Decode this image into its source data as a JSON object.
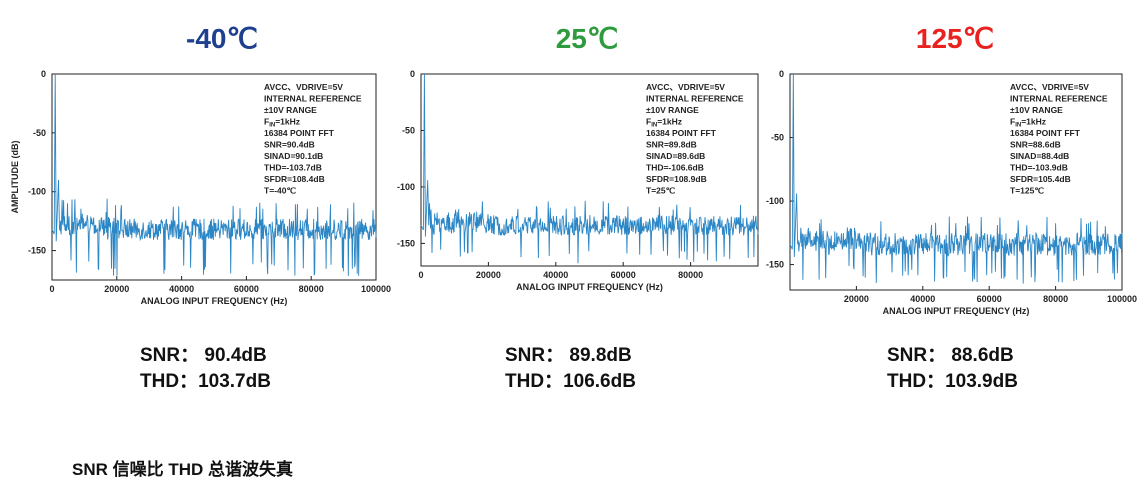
{
  "footer_note": "SNR 信噪比  THD 总谐波失真",
  "chart_data": [
    {
      "type": "line",
      "temperature_label": "-40℃",
      "temperature_color": "#1f3f8f",
      "xlabel": "ANALOG INPUT FREQUENCY (Hz)",
      "ylabel": "AMPLITUDE (dB)",
      "xlim": [
        0,
        100000
      ],
      "ylim": [
        -175,
        0
      ],
      "xticks": [
        0,
        20000,
        40000,
        60000,
        80000,
        100000
      ],
      "xtick_labels": [
        "0",
        "20000",
        "40000",
        "60000",
        "80000",
        "100000"
      ],
      "yticks": [
        0,
        -50,
        -100,
        -150
      ],
      "ytick_labels": [
        "0",
        "-50",
        "-100",
        "-150"
      ],
      "grid": false,
      "legend_position": "top-right",
      "series": [
        {
          "color": "#2b86c5",
          "fundamental": {
            "x": 1000,
            "y": 0
          },
          "noise_floor_db": -132,
          "noise_min_db": -172,
          "noise_max_db": -108
        }
      ],
      "annotations": [
        "AVCC、VDRIVE=5V",
        "INTERNAL REFERENCE",
        "±10V RANGE",
        "FIN=1kHz",
        "16384 POINT FFT",
        "SNR=90.4dB",
        "SINAD=90.1dB",
        "THD=-103.7dB",
        "SFDR=108.4dB",
        "T=-40℃"
      ],
      "summary": {
        "snr_label": "SNR：",
        "snr_value": "90.4dB",
        "thd_label": "THD：",
        "thd_value": "103.7dB"
      }
    },
    {
      "type": "line",
      "temperature_label": "25℃",
      "temperature_color": "#2e9c3e",
      "xlabel": "ANALOG INPUT FREQUENCY (Hz)",
      "ylabel": "",
      "xlim": [
        0,
        100000
      ],
      "ylim": [
        -170,
        0
      ],
      "xticks": [
        0,
        20000,
        40000,
        60000,
        80000
      ],
      "xtick_labels": [
        "0",
        "20000",
        "40000",
        "60000",
        "80000"
      ],
      "yticks": [
        0,
        -50,
        -100,
        -150
      ],
      "ytick_labels": [
        "0",
        "-50",
        "-100",
        "-150"
      ],
      "grid": false,
      "legend_position": "top-right",
      "series": [
        {
          "color": "#2b86c5",
          "fundamental": {
            "x": 1000,
            "y": 0
          },
          "noise_floor_db": -134,
          "noise_min_db": -168,
          "noise_max_db": -112
        }
      ],
      "annotations": [
        "AVCC、VDRIVE=5V",
        "INTERNAL REFERENCE",
        "±10V RANGE",
        "FIN=1kHz",
        "16384 POINT FFT",
        "SNR=89.8dB",
        "SINAD=89.6dB",
        "THD=-106.6dB",
        "SFDR=108.9dB",
        "T=25℃"
      ],
      "summary": {
        "snr_label": "SNR：",
        "snr_value": "89.8dB",
        "thd_label": "THD：",
        "thd_value": "106.6dB"
      }
    },
    {
      "type": "line",
      "temperature_label": "125℃",
      "temperature_color": "#e8231f",
      "xlabel": "ANALOG INPUT FREQUENCY (Hz)",
      "ylabel": "",
      "xlim": [
        0,
        100000
      ],
      "ylim": [
        -170,
        0
      ],
      "xticks": [
        20000,
        40000,
        60000,
        80000,
        100000
      ],
      "xtick_labels": [
        "20000",
        "40000",
        "60000",
        "80000",
        "100000"
      ],
      "yticks": [
        0,
        -50,
        -100,
        -150
      ],
      "ytick_labels": [
        "0",
        "-50",
        "-100",
        "-150"
      ],
      "grid": false,
      "legend_position": "top-right",
      "series": [
        {
          "color": "#2b86c5",
          "fundamental": {
            "x": 1000,
            "y": 0
          },
          "noise_floor_db": -134,
          "noise_min_db": -166,
          "noise_max_db": -112
        }
      ],
      "annotations": [
        "AVCC、VDRIVE=5V",
        "INTERNAL REFERENCE",
        "±10V RANGE",
        "FIN=1kHz",
        "16384 POINT FFT",
        "SNR=88.6dB",
        "SINAD=88.4dB",
        "THD=-103.9dB",
        "SFDR=105.4dB",
        "T=125℃"
      ],
      "summary": {
        "snr_label": "SNR：",
        "snr_value": "88.6dB",
        "thd_label": "THD：",
        "thd_value": "103.9dB"
      }
    }
  ]
}
